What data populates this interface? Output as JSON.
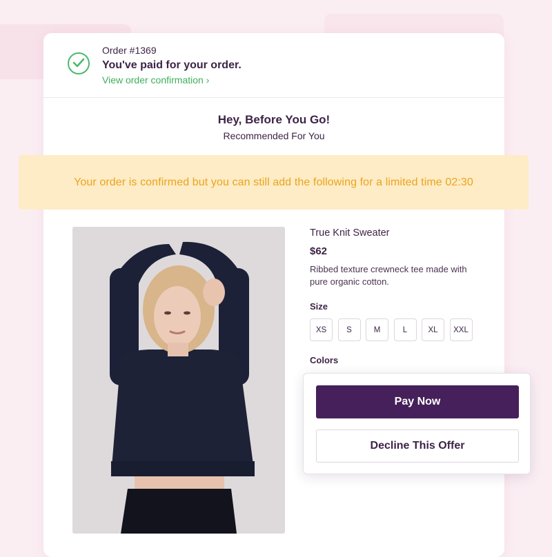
{
  "order": {
    "number": "Order #1369",
    "status": "You've paid for your order.",
    "view_link": "View order confirmation ›",
    "status_icon": "check-circle-icon"
  },
  "upsell": {
    "headline": "Hey, Before You Go!",
    "subheadline": "Recommended For You",
    "notice": "Your order is confirmed but you can still add the following for a limited time 02:30"
  },
  "product": {
    "name": "True Knit Sweater",
    "price": "$62",
    "description": "Ribbed texture crewneck tee made with pure organic cotton.",
    "size_label": "Size",
    "sizes": [
      "XS",
      "S",
      "M",
      "L",
      "XL",
      "XXL"
    ],
    "colors_label": "Colors"
  },
  "actions": {
    "pay": "Pay Now",
    "decline": "Decline This Offer"
  },
  "colors": {
    "accent": "#45205a",
    "success": "#4cb96a",
    "notice_bg": "#fdecc6",
    "notice_text": "#eba31c",
    "background": "#fbeef3"
  }
}
